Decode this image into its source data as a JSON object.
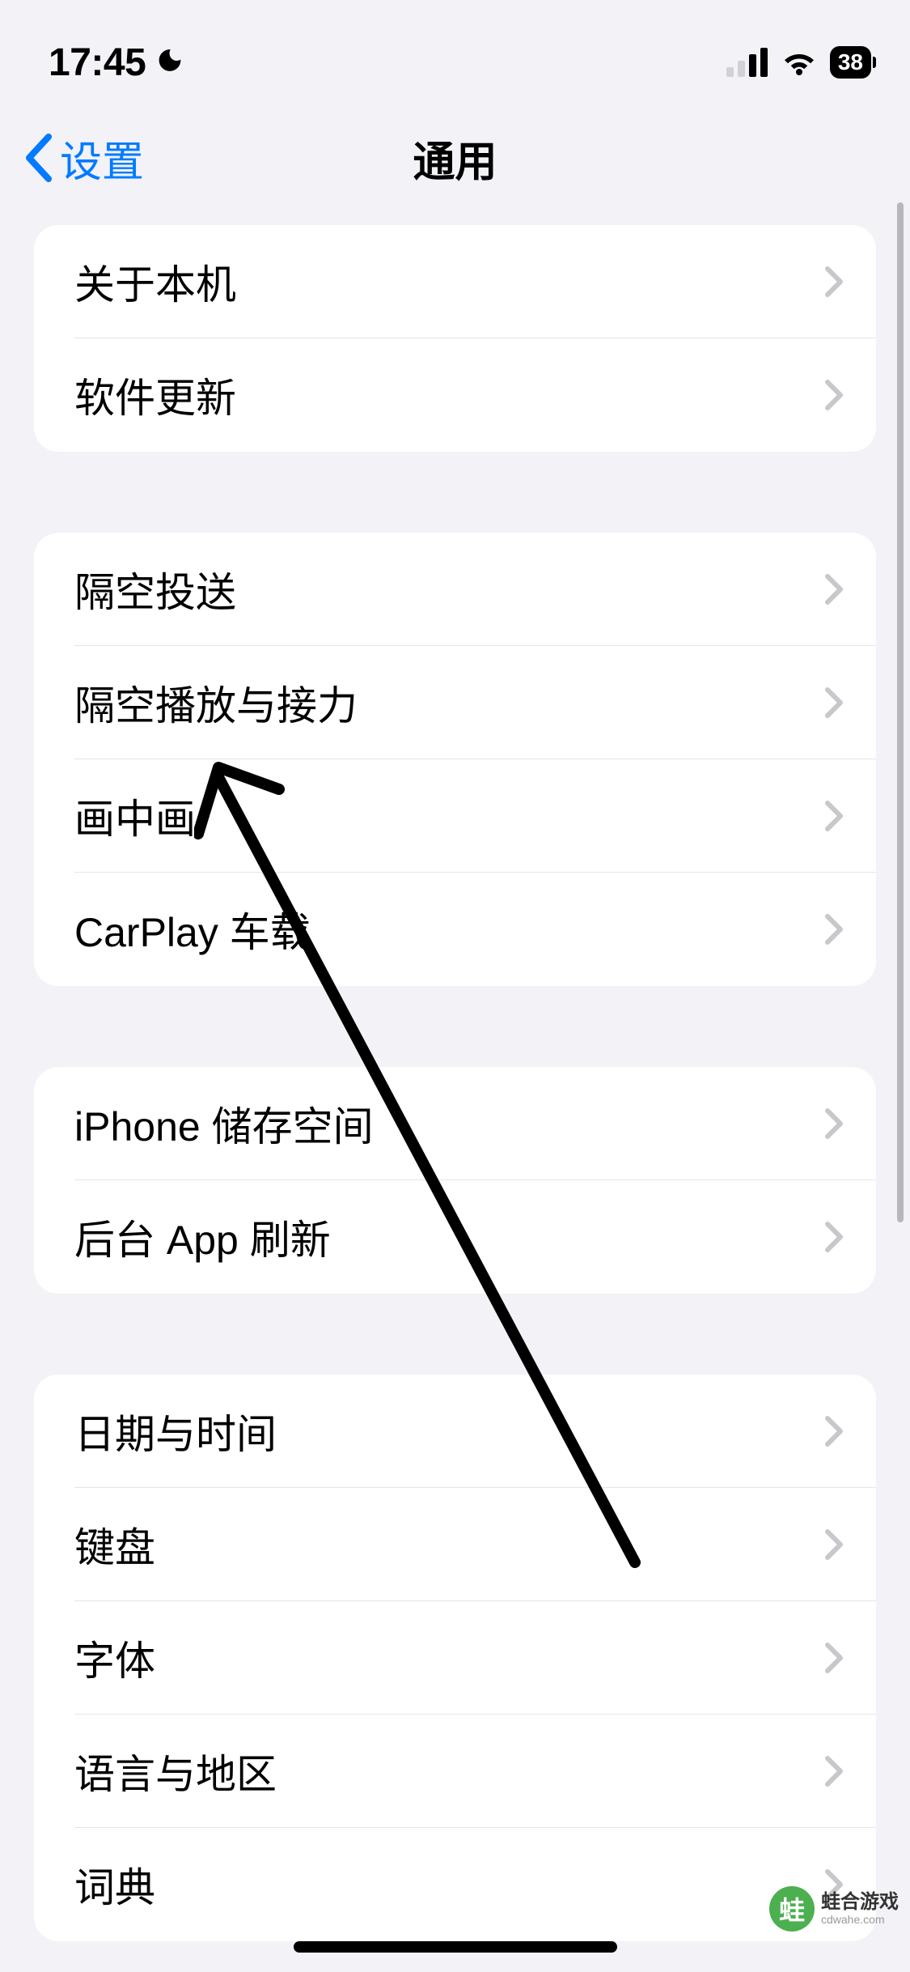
{
  "statusbar": {
    "time": "17:45",
    "battery": "38"
  },
  "nav": {
    "back_label": "设置",
    "title": "通用"
  },
  "groups": [
    {
      "rows": [
        {
          "label": "关于本机"
        },
        {
          "label": "软件更新"
        }
      ]
    },
    {
      "rows": [
        {
          "label": "隔空投送"
        },
        {
          "label": "隔空播放与接力"
        },
        {
          "label": "画中画"
        },
        {
          "label": "CarPlay 车载"
        }
      ]
    },
    {
      "rows": [
        {
          "label": "iPhone 储存空间"
        },
        {
          "label": "后台 App 刷新"
        }
      ]
    },
    {
      "rows": [
        {
          "label": "日期与时间"
        },
        {
          "label": "键盘"
        },
        {
          "label": "字体"
        },
        {
          "label": "语言与地区"
        },
        {
          "label": "词典"
        }
      ]
    }
  ],
  "watermark": {
    "main": "蛙合游戏",
    "sub": "cdwahe.com"
  }
}
